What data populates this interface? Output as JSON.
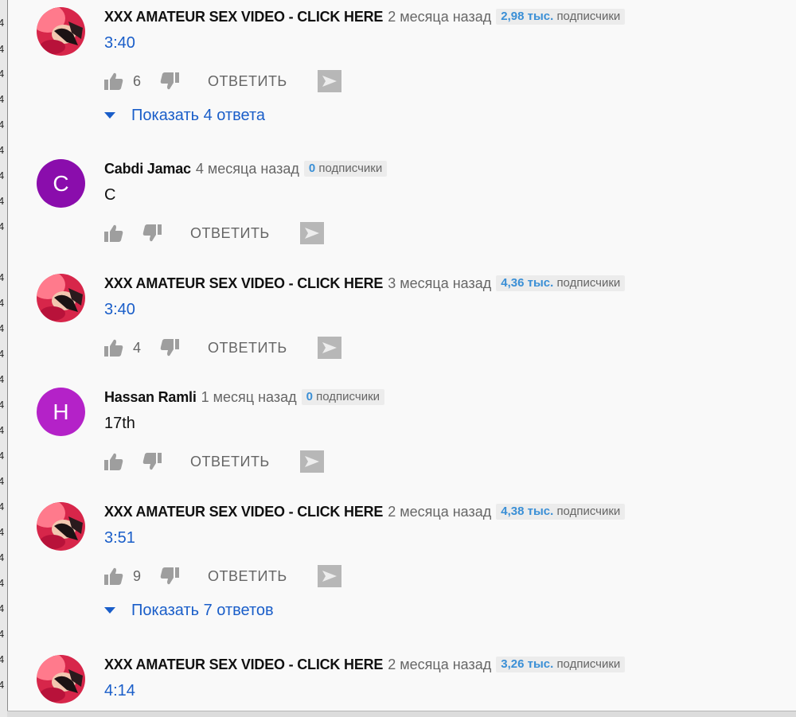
{
  "comments": [
    {
      "author": "XXX AMATEUR SEX VIDEO - CLICK HERE",
      "time": "2 месяца назад",
      "subs_count": "2,98 тыс.",
      "subs_label": "подписчики",
      "text": "3:40",
      "likes": "6",
      "reply_label": "ОТВЕТИТЬ",
      "show_replies": "Показать 4 ответа"
    },
    {
      "author": "Cabdi Jamac",
      "avatar_letter": "C",
      "avatar_color": "#8a0dac",
      "time": "4 месяца назад",
      "subs_count": "0",
      "subs_label": "подписчики",
      "text": "C",
      "reply_label": "ОТВЕТИТЬ"
    },
    {
      "author": "XXX AMATEUR SEX VIDEO - CLICK HERE",
      "time": "3 месяца назад",
      "subs_count": "4,36 тыс.",
      "subs_label": "подписчики",
      "text": "3:40",
      "likes": "4",
      "reply_label": "ОТВЕТИТЬ"
    },
    {
      "author": "Hassan Ramli",
      "avatar_letter": "H",
      "avatar_color": "#b422c8",
      "time": "1 месяц назад",
      "subs_count": "0",
      "subs_label": "подписчики",
      "text": "17th",
      "reply_label": "ОТВЕТИТЬ"
    },
    {
      "author": "XXX AMATEUR SEX VIDEO - CLICK HERE",
      "time": "2 месяца назад",
      "subs_count": "4,38 тыс.",
      "subs_label": "подписчики",
      "text": "3:51",
      "likes": "9",
      "reply_label": "ОТВЕТИТЬ",
      "show_replies": "Показать 7 ответов"
    },
    {
      "author": "XXX AMATEUR SEX VIDEO - CLICK HERE",
      "time": "2 месяца назад",
      "subs_count": "3,26 тыс.",
      "subs_label": "подписчики",
      "text": "4:14"
    }
  ],
  "left_strip_glyph": "4",
  "colors": {
    "link": "#1a5ec9",
    "subs_number": "#3a8fd6",
    "icon_gray": "#9e9e9e"
  }
}
